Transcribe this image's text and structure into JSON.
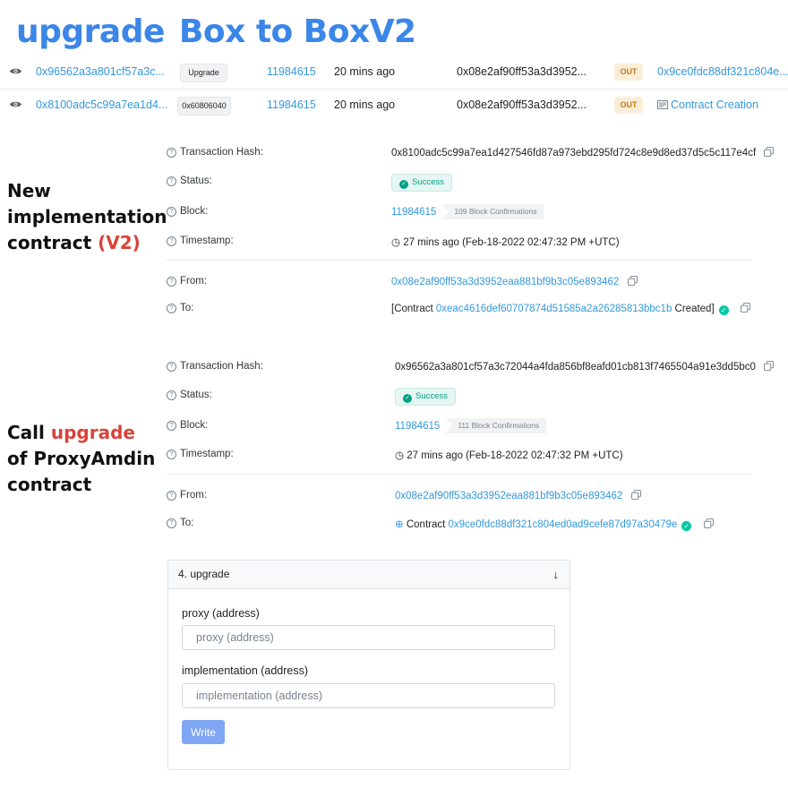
{
  "header": {
    "title_part1": "upgrade",
    "title_part2": "Box to BoxV2"
  },
  "tx_rows": [
    {
      "hash": "0x96562a3a801cf57a3c...",
      "method": "Upgrade",
      "block": "11984615",
      "age": "20 mins ago",
      "from": "0x08e2af90ff53a3d3952...",
      "direction": "OUT",
      "to": "0x9ce0fdc88df321c804e..."
    },
    {
      "hash": "0x8100adc5c99a7ea1d4...",
      "method": "0x60806040",
      "block": "11984615",
      "age": "20 mins ago",
      "from": "0x08e2af90ff53a3d3952...",
      "direction": "OUT",
      "to": "Contract Creation"
    }
  ],
  "annotations": {
    "new_impl": {
      "line1": "New",
      "line2": "implementation",
      "line3_prefix": "contract ",
      "line3_highlight": "(V2)"
    },
    "call_upgrade": {
      "line1_prefix": "Call ",
      "line1_highlight": "upgrade",
      "line2": "of ProxyAmdin",
      "line3": "contract"
    }
  },
  "detail_labels": {
    "tx_hash": "Transaction Hash:",
    "status": "Status:",
    "block": "Block:",
    "timestamp": "Timestamp:",
    "from": "From:",
    "to": "To:"
  },
  "tx1": {
    "hash": "0x8100adc5c99a7ea1d427546fd87a973ebd295fd724c8e9d8ed37d5c5c117e4cf",
    "status": "Success",
    "block": "11984615",
    "confirmations": "109 Block Confirmations",
    "timestamp": "27 mins ago (Feb-18-2022 02:47:32 PM +UTC)",
    "from": "0x08e2af90ff53a3d3952eaa881bf9b3c05e893462",
    "to_prefix": "[Contract ",
    "to_address": "0xeac4616def60707874d51585a2a26285813bbc1b",
    "to_suffix": " Created]"
  },
  "tx2": {
    "hash": "0x96562a3a801cf57a3c72044a4fda856bf8eafd01cb813f7465504a91e3dd5bc0",
    "status": "Success",
    "block": "11984615",
    "confirmations": "111 Block Confirmations",
    "timestamp": "27 mins ago (Feb-18-2022 02:47:32 PM +UTC)",
    "from": "0x08e2af90ff53a3d3952eaa881bf9b3c05e893462",
    "to_prefix": "Contract ",
    "to_address": "0x9ce0fdc88df321c804ed0ad9cefe87d97a30479e"
  },
  "write_card": {
    "title": "4. upgrade",
    "proxy_label": "proxy (address)",
    "proxy_placeholder": "proxy (address)",
    "impl_label": "implementation (address)",
    "impl_placeholder": "implementation (address)",
    "button": "Write"
  },
  "colors": {
    "title_blue": "#3b86e8",
    "link_blue": "#3498db",
    "highlight_red": "#d9433a",
    "success_green": "#00a186",
    "out_badge_bg": "#fbeed9",
    "write_button": "#7fa6f3"
  },
  "icons": [
    "eye-icon",
    "question-circle-icon",
    "copy-icon",
    "check-circle-icon",
    "clock-icon",
    "contract-search-icon",
    "contract-file-icon",
    "chevron-down-icon"
  ]
}
